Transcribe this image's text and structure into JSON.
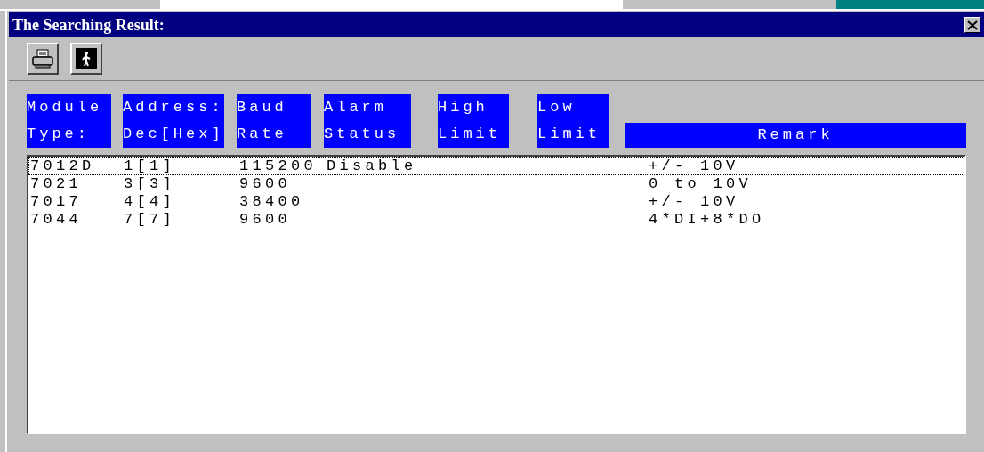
{
  "window": {
    "title": "The Searching Result:"
  },
  "toolbar": {
    "buttons": [
      {
        "kind": "print"
      },
      {
        "kind": "exit"
      }
    ]
  },
  "table": {
    "columns": [
      {
        "lines": [
          "Module",
          "Type:"
        ]
      },
      {
        "lines": [
          "Address:",
          "Dec[Hex]"
        ]
      },
      {
        "lines": [
          "Baud",
          "Rate"
        ]
      },
      {
        "lines": [
          "Alarm",
          "Status"
        ]
      },
      {
        "lines": [
          "High",
          "Limit"
        ]
      },
      {
        "lines": [
          "Low",
          "Limit"
        ]
      },
      {
        "lines": [
          "Remark"
        ]
      }
    ],
    "rows": [
      {
        "selected": true,
        "cells": [
          "7012D",
          "1[1]",
          "115200",
          "Disable",
          "",
          "",
          "+/- 10V"
        ]
      },
      {
        "selected": false,
        "cells": [
          "7021",
          "3[3]",
          "9600",
          "",
          "",
          "",
          "0 to 10V"
        ]
      },
      {
        "selected": false,
        "cells": [
          "7017",
          "4[4]",
          "38400",
          "",
          "",
          "",
          "+/- 10V"
        ]
      },
      {
        "selected": false,
        "cells": [
          "7044",
          "7[7]",
          "9600",
          "",
          "",
          "",
          "4*DI+8*DO"
        ]
      }
    ]
  }
}
